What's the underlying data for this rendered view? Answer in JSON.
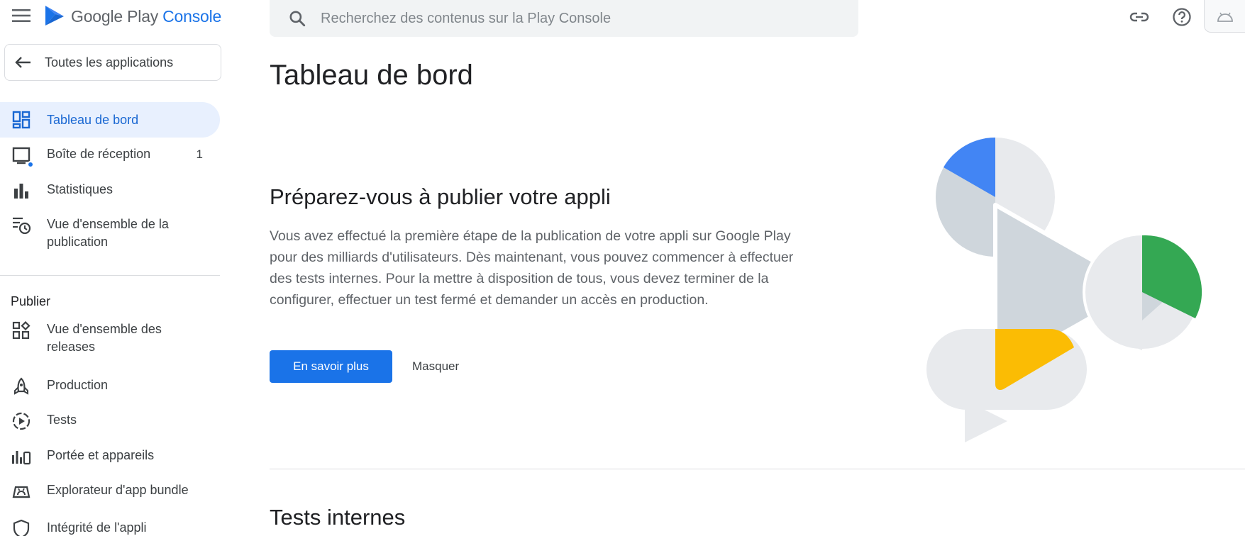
{
  "header": {
    "brand": "Google Play",
    "brand_accent": "Console",
    "search_placeholder": "Recherchez des contenus sur la Play Console"
  },
  "sidebar": {
    "back_label": "Toutes les applications",
    "items": [
      {
        "label": "Tableau de bord",
        "icon": "dashboard-icon",
        "active": true
      },
      {
        "label": "Boîte de réception",
        "icon": "inbox-icon",
        "count": "1"
      },
      {
        "label": "Statistiques",
        "icon": "bar-chart-icon"
      },
      {
        "label": "Vue d'ensemble de la publication",
        "icon": "publishing-overview-icon"
      }
    ],
    "section_title": "Publier",
    "publish_items": [
      {
        "label": "Vue d'ensemble des releases",
        "icon": "releases-overview-icon"
      },
      {
        "label": "Production",
        "icon": "production-icon"
      },
      {
        "label": "Tests",
        "icon": "testing-icon"
      },
      {
        "label": "Portée et appareils",
        "icon": "reach-devices-icon"
      },
      {
        "label": "Explorateur d'app bundle",
        "icon": "app-bundle-explorer-icon"
      },
      {
        "label": "Intégrité de l'appli",
        "icon": "app-integrity-icon"
      }
    ]
  },
  "main": {
    "page_title": "Tableau de bord",
    "card": {
      "title": "Préparez-vous à publier votre appli",
      "body": "Vous avez effectué la première étape de la publication de votre appli sur Google Play pour des milliards d'utilisateurs. Dès maintenant, vous pouvez commencer à effectuer des tests internes. Pour la mettre à disposition de tous, vous devez terminer de la configurer, effectuer un test fermé et demander un accès en production.",
      "primary_button": "En savoir plus",
      "secondary_button": "Masquer"
    },
    "next_section_title": "Tests internes"
  },
  "colors": {
    "accent": "#1a73e8",
    "active_bg": "#e8f0fe",
    "illustration_blue": "#4285f4",
    "illustration_green": "#34a853",
    "illustration_yellow": "#fbbc04",
    "illustration_grey": "#cfd6dc"
  }
}
